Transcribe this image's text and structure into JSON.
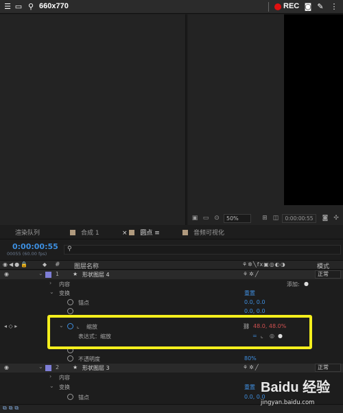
{
  "topbar": {
    "title": "660x770",
    "rec_label": "REC"
  },
  "viewer_toolbar": {
    "zoom": "50%",
    "timecode": "0:00:00:55"
  },
  "tabs": [
    {
      "label": "渲染队列"
    },
    {
      "label": "合成 1"
    },
    {
      "label": "圆点"
    },
    {
      "label": "音频可视化"
    }
  ],
  "timeline": {
    "timecode": "0:00:00:55",
    "fps": "00055 (60.00 fps)",
    "header": {
      "number": "#",
      "layer_name": "图层名称",
      "mode": "模式"
    }
  },
  "layers": [
    {
      "number": "1",
      "name": "形状图层 4",
      "mode": "正常",
      "contents": "内容",
      "add": "添加:",
      "transform": "变换",
      "reset": "重置",
      "anchor_label": "锚点",
      "anchor_value": "0.0, 0.0",
      "position_value": "0.0, 0.0",
      "scale_label": "缩放",
      "scale_value": "48.0, 48.0%",
      "expression_label": "表达式：缩放",
      "opacity_label": "不透明度",
      "opacity_value": "80%"
    },
    {
      "number": "2",
      "name": "形状图层 3",
      "mode": "正常",
      "contents": "内容",
      "transform": "变换",
      "reset": "重置",
      "anchor_label": "锚点",
      "anchor_value": "0.0, 0.0"
    }
  ],
  "watermark": {
    "logo": "Baidu 经验",
    "url": "jingyan.baidu.com"
  },
  "colors": {
    "timecode": "#3d8fe0",
    "value": "#3f8fe0",
    "highlight": "#f4ef1d",
    "rec": "#e01010",
    "scale_value": "#d05050"
  }
}
